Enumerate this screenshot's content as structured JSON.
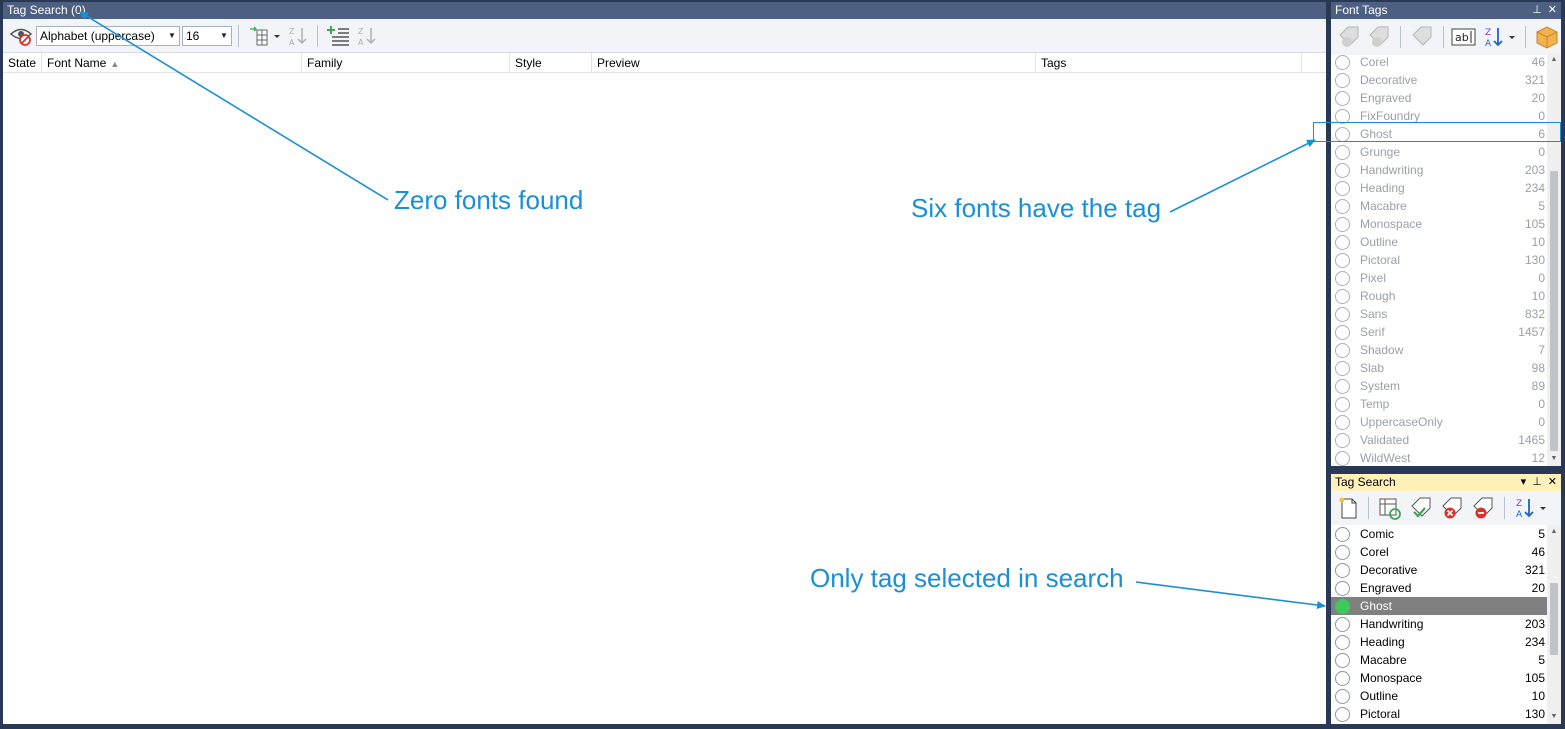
{
  "main": {
    "title": "Tag Search (0)",
    "charset_combo": "Alphabet (uppercase)",
    "size_combo": "16",
    "columns": [
      "State",
      "Font Name",
      "Family",
      "Style",
      "Preview",
      "Tags"
    ]
  },
  "font_tags": {
    "title": "Font Tags",
    "items": [
      {
        "name": "Corel",
        "count": "46"
      },
      {
        "name": "Decorative",
        "count": "321"
      },
      {
        "name": "Engraved",
        "count": "20"
      },
      {
        "name": "FixFoundry",
        "count": "0"
      },
      {
        "name": "Ghost",
        "count": "6"
      },
      {
        "name": "Grunge",
        "count": "0"
      },
      {
        "name": "Handwriting",
        "count": "203"
      },
      {
        "name": "Heading",
        "count": "234"
      },
      {
        "name": "Macabre",
        "count": "5"
      },
      {
        "name": "Monospace",
        "count": "105"
      },
      {
        "name": "Outline",
        "count": "10"
      },
      {
        "name": "Pictoral",
        "count": "130"
      },
      {
        "name": "Pixel",
        "count": "0"
      },
      {
        "name": "Rough",
        "count": "10"
      },
      {
        "name": "Sans",
        "count": "832"
      },
      {
        "name": "Serif",
        "count": "1457"
      },
      {
        "name": "Shadow",
        "count": "7"
      },
      {
        "name": "Slab",
        "count": "98"
      },
      {
        "name": "System",
        "count": "89"
      },
      {
        "name": "Temp",
        "count": "0"
      },
      {
        "name": "UppercaseOnly",
        "count": "0"
      },
      {
        "name": "Validated",
        "count": "1465"
      },
      {
        "name": "WildWest",
        "count": "12"
      }
    ]
  },
  "tag_search": {
    "title": "Tag Search",
    "items": [
      {
        "name": "Comic",
        "count": "5"
      },
      {
        "name": "Corel",
        "count": "46"
      },
      {
        "name": "Decorative",
        "count": "321"
      },
      {
        "name": "Engraved",
        "count": "20"
      },
      {
        "name": "Ghost",
        "count": "",
        "selected": true
      },
      {
        "name": "Handwriting",
        "count": "203"
      },
      {
        "name": "Heading",
        "count": "234"
      },
      {
        "name": "Macabre",
        "count": "5"
      },
      {
        "name": "Monospace",
        "count": "105"
      },
      {
        "name": "Outline",
        "count": "10"
      },
      {
        "name": "Pictoral",
        "count": "130"
      }
    ]
  },
  "annotations": {
    "zero_fonts": "Zero fonts found",
    "six_fonts": "Six fonts have the tag",
    "only_tag": "Only tag selected in search"
  },
  "colors": {
    "frame": "#293955",
    "titlebar": "#4d6082",
    "active_titlebar": "#fff1b8",
    "annotation": "#1b8fd6",
    "selected_row": "#808080",
    "selected_radio": "#3ec95d"
  }
}
